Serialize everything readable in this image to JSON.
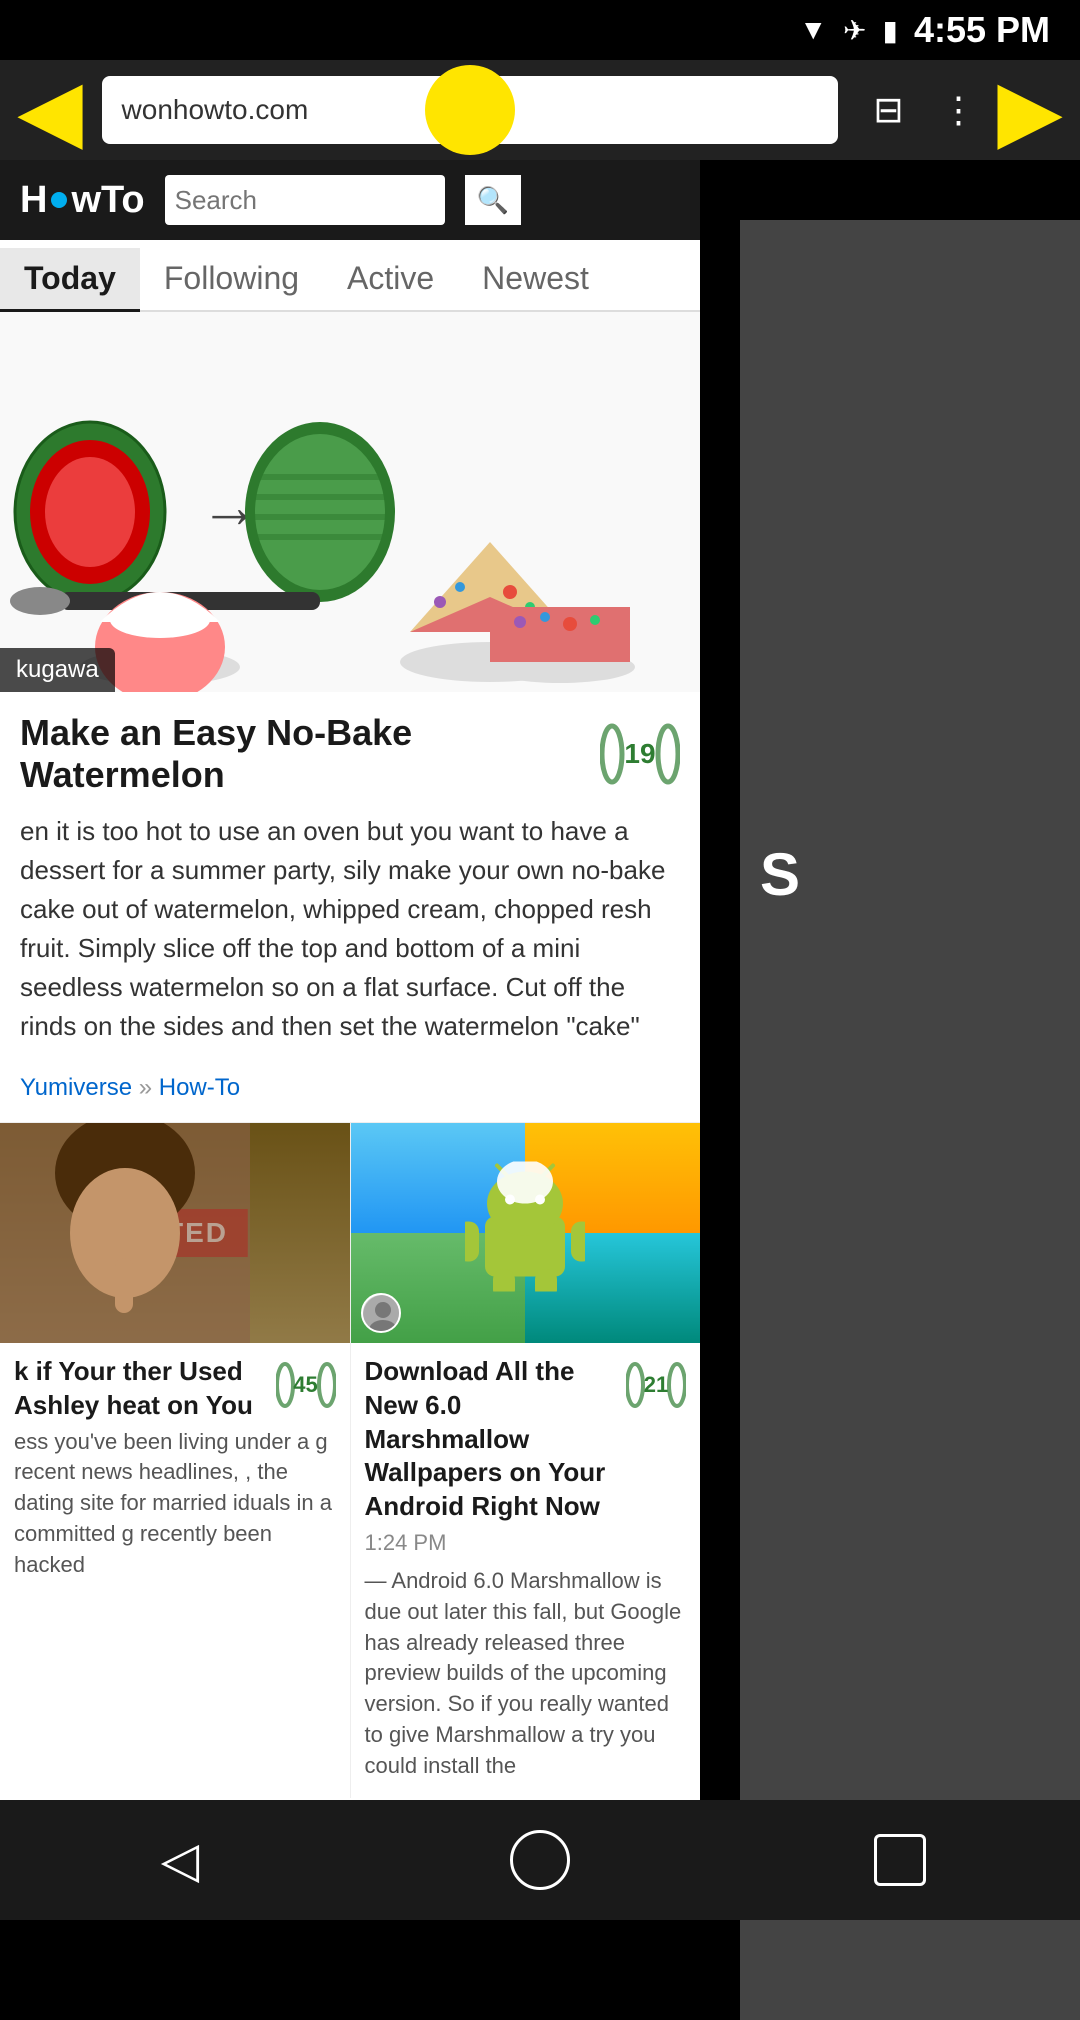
{
  "statusBar": {
    "time": "4:55 PM"
  },
  "browserChrome": {
    "urlText": "wonhowto.com",
    "tabsLabel": "⊟",
    "menuLabel": "⋮"
  },
  "siteHeader": {
    "logoText": "HowTo",
    "searchPlaceholder": "Search",
    "searchButtonLabel": "🔍"
  },
  "navTabs": {
    "tabs": [
      {
        "label": "Today",
        "active": true
      },
      {
        "label": "Following",
        "active": false
      },
      {
        "label": "Active",
        "active": false
      },
      {
        "label": "Newest",
        "active": false
      }
    ]
  },
  "mainArticle": {
    "authorBadge": "kugawa",
    "title": "Make an Easy No-Bake Watermelon",
    "votes": "19",
    "excerpt": "en it is too hot to use an oven but you want to have a dessert for a summer party, sily make your own no-bake cake out of watermelon, whipped cream, chopped resh fruit. Simply slice off the top and bottom of a mini seedless watermelon so on a flat surface. Cut off the rinds on the sides and then set the watermelon \"cake\"",
    "breadcrumb": "Yumiverse",
    "breadcrumbSep": " » ",
    "breadcrumbSub": "How-To"
  },
  "gridArticles": [
    {
      "title": "k if Your ther Used Ashley heat on You",
      "votes": "45",
      "time": "",
      "excerpt": "ess you've been living under a g recent news headlines, , the dating site for married iduals in a committed g recently been hacked"
    },
    {
      "title": "Download All the New 6.0 Marshmallow Wallpapers on Your Android Right Now",
      "votes": "21",
      "time": "1:24 PM",
      "excerpt": "— Android 6.0 Marshmallow is due out later this fall, but Google has already released three preview builds of the upcoming version. So if you really wanted to give Marshmallow a try you could install the"
    }
  ],
  "rightPanel": {
    "letter": "S"
  },
  "bottomNav": {
    "backLabel": "◁",
    "homeLabel": "",
    "recentsLabel": ""
  }
}
